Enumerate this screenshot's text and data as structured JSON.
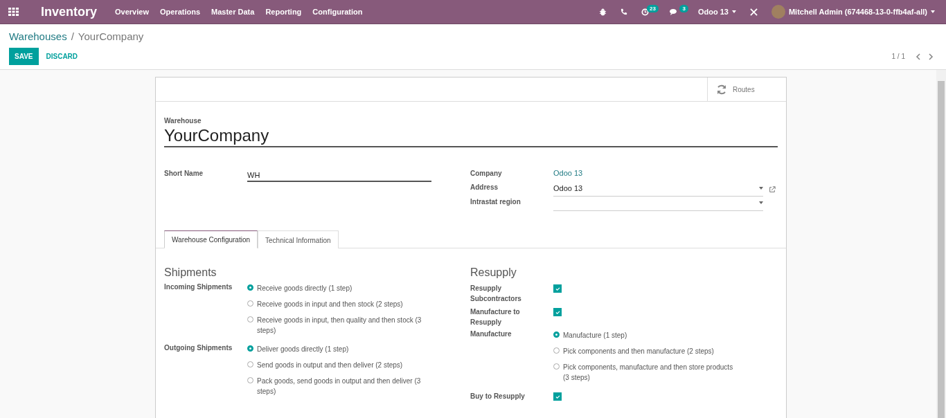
{
  "navbar": {
    "app_title": "Inventory",
    "menu": [
      "Overview",
      "Operations",
      "Master Data",
      "Reporting",
      "Configuration"
    ],
    "activities_count": "23",
    "messages_count": "3",
    "company": "Odoo 13",
    "user": "Mitchell Admin (674468-13-0-ffb4af-all)"
  },
  "breadcrumb": {
    "items": [
      "Warehouses",
      "YourCompany"
    ],
    "separator": "/"
  },
  "actions": {
    "save": "SAVE",
    "discard": "DISCARD",
    "pager": "1 / 1"
  },
  "form": {
    "smart_button": "Routes",
    "name_label": "Warehouse",
    "name": "YourCompany",
    "left_fields": [
      {
        "label": "Short Name",
        "kind": "text",
        "value": "WH"
      }
    ],
    "right_fields": [
      {
        "label": "Company",
        "kind": "link",
        "value": "Odoo 13"
      },
      {
        "label": "Address",
        "kind": "select",
        "value": "Odoo 13",
        "external_link": true
      },
      {
        "label": "Intrastat region",
        "kind": "select",
        "external_link": false
      }
    ],
    "tabs": [
      {
        "label": "Warehouse Configuration",
        "selected": true
      },
      {
        "label": "Technical Information",
        "selected": false
      }
    ],
    "sections": [
      {
        "title": "Shipments",
        "rows": [
          {
            "label": "Incoming Shipments",
            "kind": "radio",
            "options": [
              {
                "label": "Receive goods directly (1 step)",
                "selected": true
              },
              {
                "label": "Receive goods in input and then stock (2 steps)",
                "selected": false
              },
              {
                "label": "Receive goods in input, then quality and then stock (3 steps)",
                "selected": false
              }
            ]
          },
          {
            "label": "Outgoing Shipments",
            "kind": "radio",
            "options": [
              {
                "label": "Deliver goods directly (1 step)",
                "selected": true
              },
              {
                "label": "Send goods in output and then deliver (2 steps)",
                "selected": false
              },
              {
                "label": "Pack goods, send goods in output and then deliver (3 steps)",
                "selected": false
              }
            ]
          }
        ]
      },
      {
        "title": "Resupply",
        "rows": [
          {
            "label": "Resupply Subcontractors",
            "kind": "checkbox",
            "checked": true
          },
          {
            "label": "Manufacture to Resupply",
            "kind": "checkbox",
            "checked": true
          },
          {
            "label": "Manufacture",
            "kind": "radio",
            "options": [
              {
                "label": "Manufacture (1 step)",
                "selected": true
              },
              {
                "label": "Pick components and then manufacture (2 steps)",
                "selected": false
              },
              {
                "label": "Pick components, manufacture and then store products (3 steps)",
                "selected": false
              }
            ]
          },
          {
            "label": "Buy to Resupply",
            "kind": "checkbox",
            "checked": true
          }
        ]
      }
    ]
  }
}
